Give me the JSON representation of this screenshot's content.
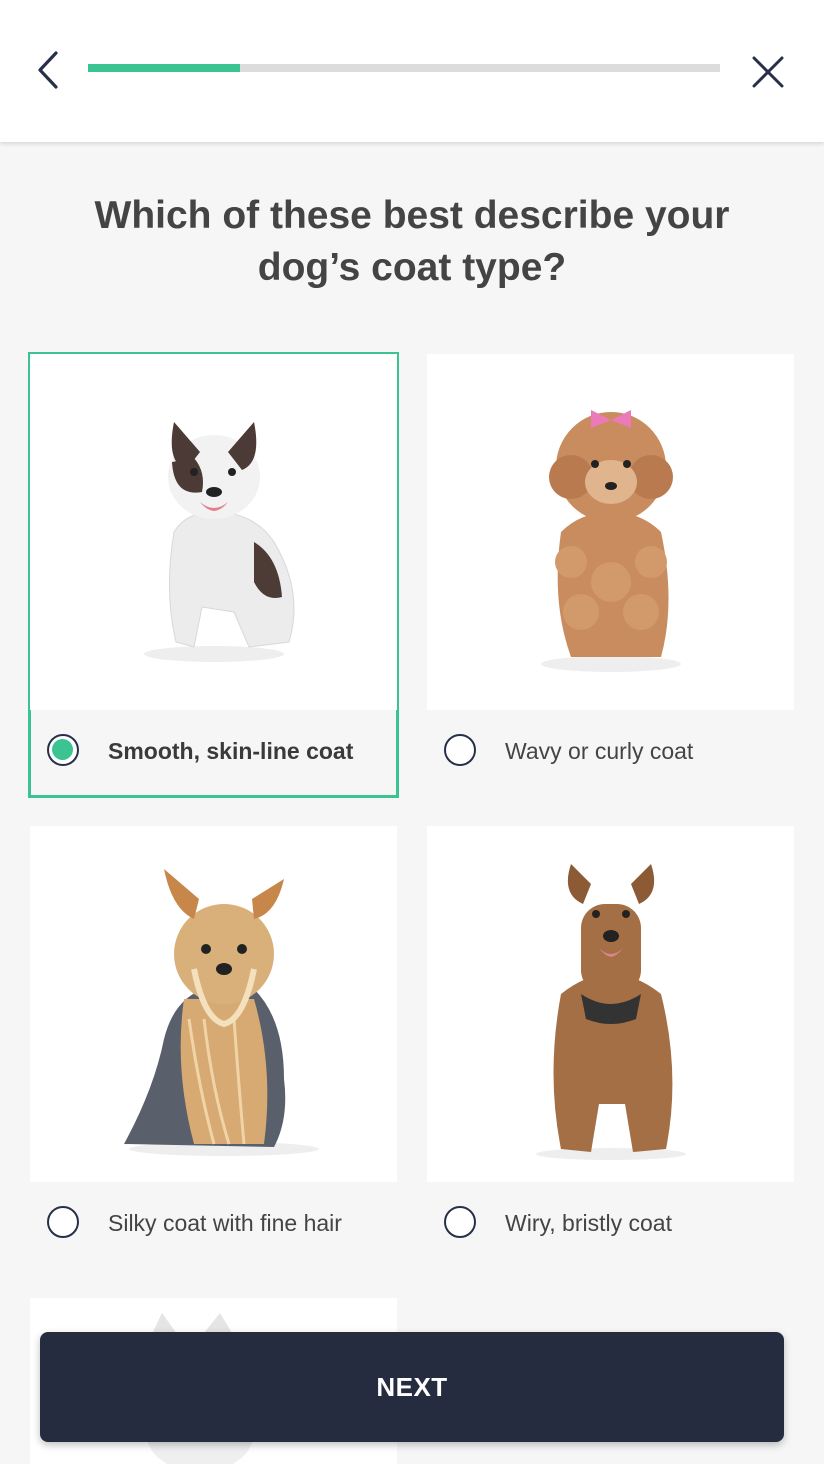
{
  "header": {
    "back_icon": "chevron-left-icon",
    "close_icon": "close-icon",
    "progress_fraction": 0.24,
    "colors": {
      "progress_fill": "#3cc392",
      "progress_track": "#dcdcdc"
    }
  },
  "question": {
    "line1": "Which of these best describe your",
    "line2": "dog’s coat type?"
  },
  "options": [
    {
      "label": "Smooth, skin-line coat",
      "selected": true,
      "image": "french-bulldog-photo"
    },
    {
      "label": "Wavy or curly coat",
      "selected": false,
      "image": "poodle-photo"
    },
    {
      "label": "Silky coat with fine hair",
      "selected": false,
      "image": "yorkshire-terrier-photo"
    },
    {
      "label": "Wiry, bristly coat",
      "selected": false,
      "image": "airedale-terrier-photo"
    }
  ],
  "next_button": {
    "label": "NEXT"
  },
  "colors": {
    "accent": "#3cc392",
    "button_bg": "#262c40",
    "radio_border": "#26304a"
  }
}
